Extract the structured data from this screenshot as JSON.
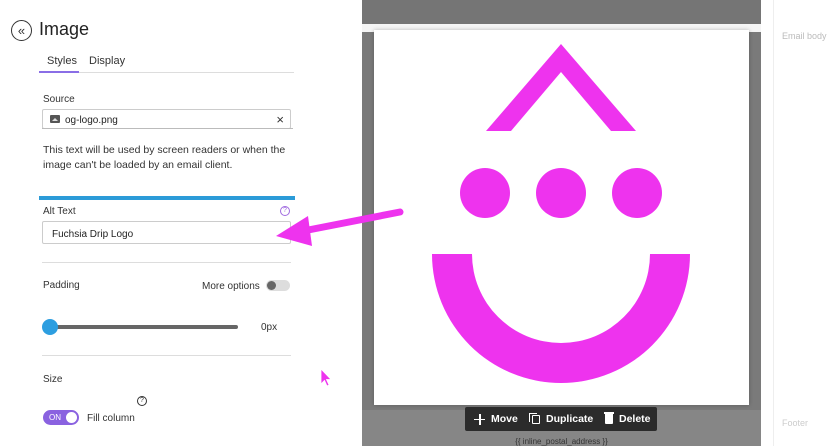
{
  "panel": {
    "title": "Image",
    "back_icon": "«",
    "tabs": [
      {
        "label": "Styles",
        "active": true
      },
      {
        "label": "Display",
        "active": false
      }
    ],
    "source": {
      "label": "Source",
      "file_name": "og-logo.png",
      "clear_icon": "×"
    },
    "alt_hint": "This text will be used by screen readers or when the image can't be loaded by an email client.",
    "alt_text": {
      "label": "Alt Text",
      "value": "Fuchsia Drip Logo",
      "help_icon": "?"
    },
    "padding": {
      "label": "Padding",
      "more_options_label": "More options",
      "more_options_on": false,
      "value_label": "0px",
      "slider_value": 0
    },
    "size": {
      "label": "Size",
      "help_icon": "?",
      "fill_column_toggle": "ON",
      "fill_column_label": "Fill column",
      "fill_column_on": true
    }
  },
  "canvas": {
    "postal": "{{ inline_postal_address }}",
    "toolbar": {
      "move": "Move",
      "duplicate": "Duplicate",
      "delete": "Delete"
    },
    "logo_color": "#ee33ee"
  },
  "right_panel": {
    "email_body_label": "Email body",
    "footer_label": "Footer"
  },
  "colors": {
    "accent": "#8a62e0",
    "slider": "#2d9ee0",
    "annotation_arrow": "#ee33ee"
  }
}
